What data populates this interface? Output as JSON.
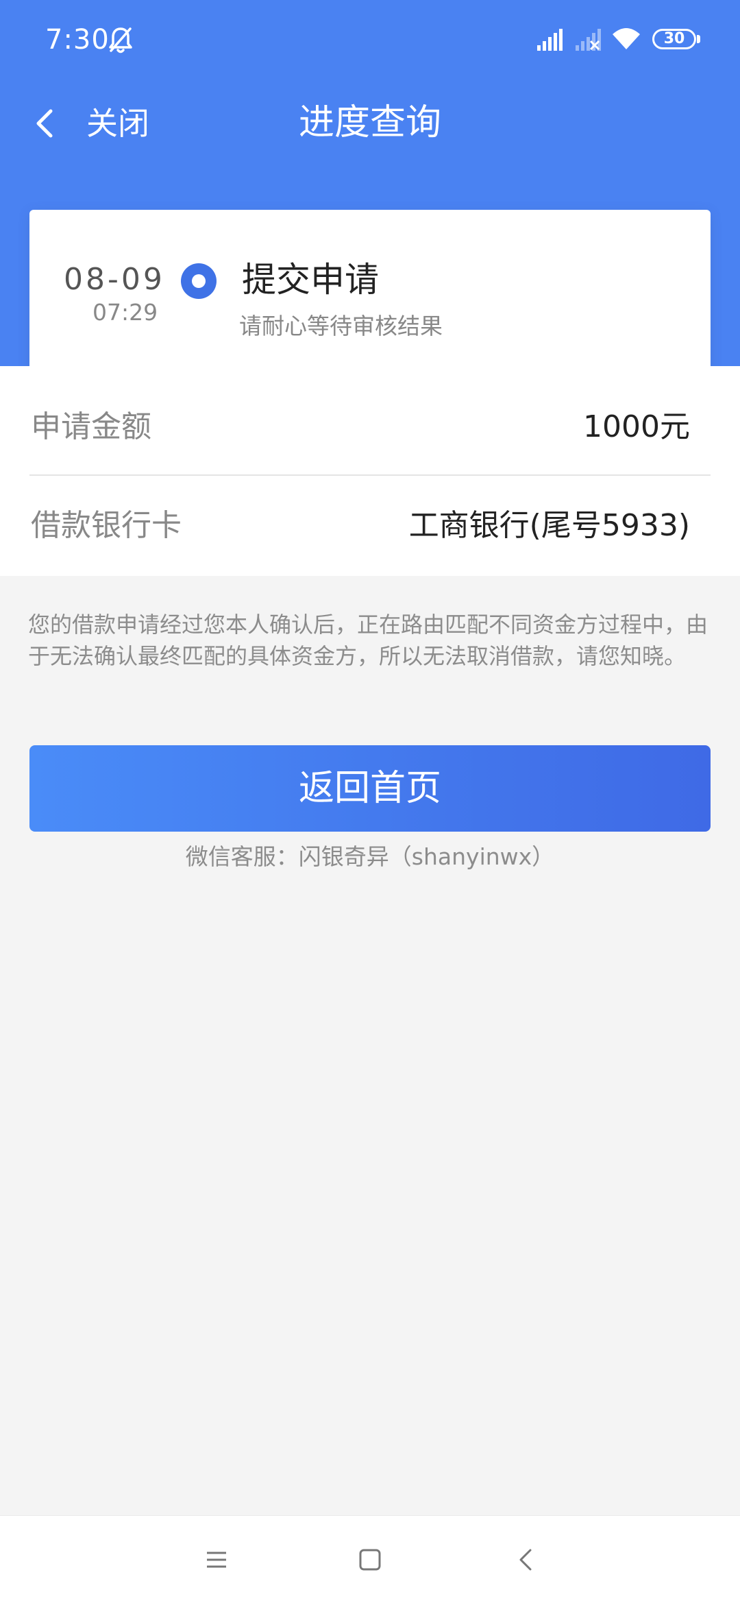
{
  "status_bar": {
    "time": "7:30",
    "battery": "30",
    "icons": [
      "bell-off-icon",
      "signal-icon",
      "signal-no-service-icon",
      "wifi-icon",
      "battery-icon"
    ]
  },
  "nav": {
    "back_label": "关闭",
    "back_icon": "chevron-left-icon",
    "title": "进度查询"
  },
  "progress": {
    "date": "08-09",
    "time": "07:29",
    "step_title": "提交申请",
    "step_desc": "请耐心等待审核结果"
  },
  "details": {
    "amount_label": "申请金额",
    "amount_value": "1000元",
    "card_label": "借款银行卡",
    "card_value": "工商银行(尾号5933)"
  },
  "notice": "您的借款申请经过您本人确认后，正在路由匹配不同资金方过程中，由于无法确认最终匹配的具体资金方，所以无法取消借款，请您知晓。",
  "actions": {
    "home_button": "返回首页"
  },
  "service": "微信客服：闪银奇异（shanyinwx）",
  "system_nav": {
    "icons": [
      "menu-icon",
      "home-square-icon",
      "back-triangle-icon"
    ]
  },
  "colors": {
    "primary": "#4a82f2",
    "step_dot": "#3f72e6",
    "background": "#f4f4f4",
    "muted_text": "#8c8c8c"
  }
}
